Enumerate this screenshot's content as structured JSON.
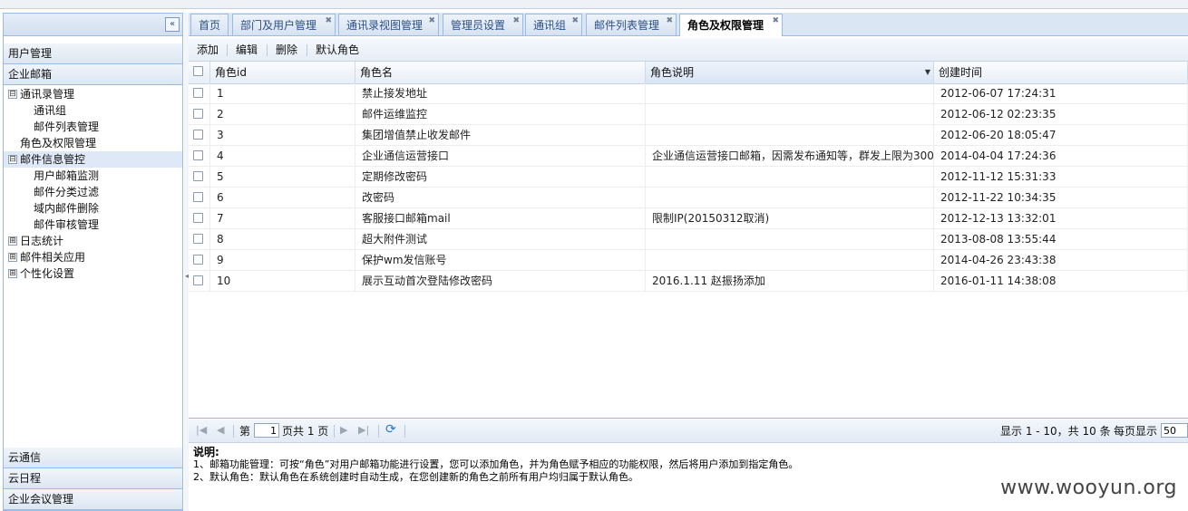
{
  "sidebar": {
    "sections": [
      {
        "label": "用户管理"
      },
      {
        "label": "企业邮箱"
      }
    ],
    "tree": [
      {
        "label": "通讯录管理",
        "level": 0,
        "toggle": "⊟"
      },
      {
        "label": "通讯组",
        "level": 1
      },
      {
        "label": "邮件列表管理",
        "level": 1
      },
      {
        "label": "角色及权限管理",
        "level": 0
      },
      {
        "label": "邮件信息管控",
        "level": 0,
        "toggle": "⊟",
        "selected": true
      },
      {
        "label": "用户邮箱监测",
        "level": 1
      },
      {
        "label": "邮件分类过滤",
        "level": 1
      },
      {
        "label": "域内邮件删除",
        "level": 1
      },
      {
        "label": "邮件审核管理",
        "level": 1
      },
      {
        "label": "日志统计",
        "level": 0,
        "toggle": "⊞"
      },
      {
        "label": "邮件相关应用",
        "level": 0,
        "toggle": "⊞"
      },
      {
        "label": "个性化设置",
        "level": 0,
        "toggle": "⊞"
      }
    ],
    "bottom_sections": [
      {
        "label": "云通信"
      },
      {
        "label": "云日程"
      },
      {
        "label": "企业会议管理"
      }
    ]
  },
  "tabs": [
    {
      "label": "首页"
    },
    {
      "label": "部门及用户管理"
    },
    {
      "label": "通讯录视图管理"
    },
    {
      "label": "管理员设置"
    },
    {
      "label": "通讯组"
    },
    {
      "label": "邮件列表管理"
    },
    {
      "label": "角色及权限管理",
      "active": true
    }
  ],
  "toolbar": {
    "add": "添加",
    "edit": "编辑",
    "delete": "删除",
    "default_role": "默认角色"
  },
  "grid": {
    "columns": [
      "角色id",
      "角色名",
      "角色说明",
      "创建时间"
    ],
    "rows": [
      {
        "id": "1",
        "name": "禁止接发地址",
        "desc": "",
        "created": "2012-06-07 17:24:31"
      },
      {
        "id": "2",
        "name": "邮件运维监控",
        "desc": "",
        "created": "2012-06-12 02:23:35"
      },
      {
        "id": "3",
        "name": "集团增值禁止收发邮件",
        "desc": "",
        "created": "2012-06-20 18:05:47"
      },
      {
        "id": "4",
        "name": "企业通信运营接口",
        "desc": "企业通信运营接口邮箱，因需发布通知等，群发上限为300",
        "created": "2014-04-04 17:24:36"
      },
      {
        "id": "5",
        "name": "定期修改密码",
        "desc": "",
        "created": "2012-11-12 15:31:33"
      },
      {
        "id": "6",
        "name": "改密码",
        "desc": "",
        "created": "2012-11-22 10:34:35"
      },
      {
        "id": "7",
        "name": "客服接口邮箱mail",
        "desc": "限制IP(20150312取消)",
        "created": "2012-12-13 13:32:01"
      },
      {
        "id": "8",
        "name": "超大附件测试",
        "desc": "",
        "created": "2013-08-08 13:55:44"
      },
      {
        "id": "9",
        "name": "保护wm发信账号",
        "desc": "",
        "created": "2014-04-26 23:43:38"
      },
      {
        "id": "10",
        "name": "展示互动首次登陆修改密码",
        "desc": "2016.1.11 赵振扬添加",
        "created": "2016-01-11 14:38:08"
      }
    ]
  },
  "pager": {
    "page_prefix": "第",
    "page_value": "1",
    "page_suffix": "页共 1 页",
    "display_info": "显示 1 - 10，共 10 条",
    "per_page_label": "每页显示",
    "per_page_value": "50"
  },
  "notes": {
    "title": "说明:",
    "line1": "1、邮箱功能管理：可按“角色”对用户邮箱功能进行设置，您可以添加角色，并为角色赋予相应的功能权限，然后将用户添加到指定角色。",
    "line2": "2、默认角色：默认角色在系统创建时自动生成，在您创建新的角色之前所有用户均归属于默认角色。"
  },
  "watermark": "www.wooyun.org"
}
